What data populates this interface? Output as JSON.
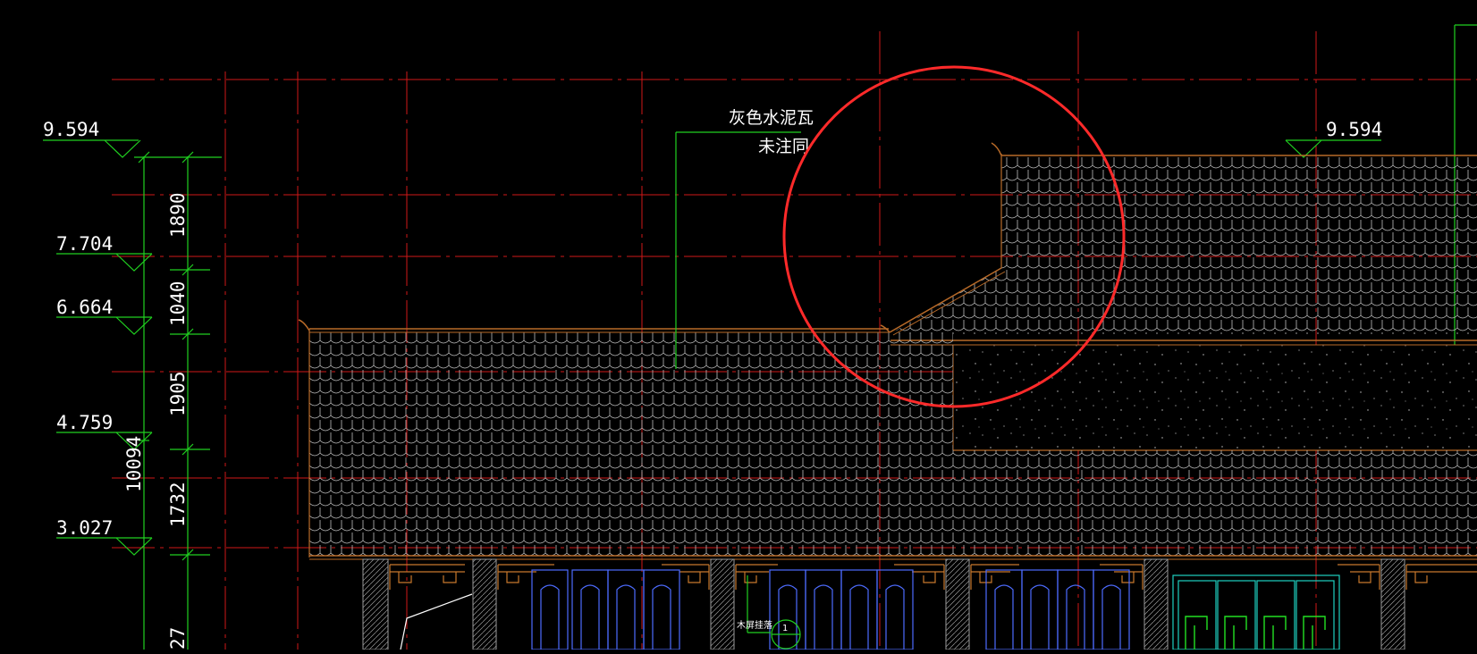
{
  "colors": {
    "background": "#000000",
    "grid": "#d01818",
    "dimension": "#20d020",
    "roof_edge": "#b86a28",
    "tile": "#b8b8b8",
    "text": "#ffffff",
    "window": "#4d6cff",
    "callout": "#ff2a2a"
  },
  "elevations": {
    "left": [
      "9.594",
      "7.704",
      "6.664",
      "4.759",
      "3.027"
    ],
    "right": "9.594"
  },
  "dimensions": {
    "segments": [
      "1890",
      "1040",
      "1905",
      "1732",
      "27"
    ],
    "total": "10094"
  },
  "annotation": {
    "line1": "灰色水泥瓦",
    "line2": "未注同"
  },
  "detail_marker": {
    "label": "木屏挂落",
    "number": "1"
  }
}
